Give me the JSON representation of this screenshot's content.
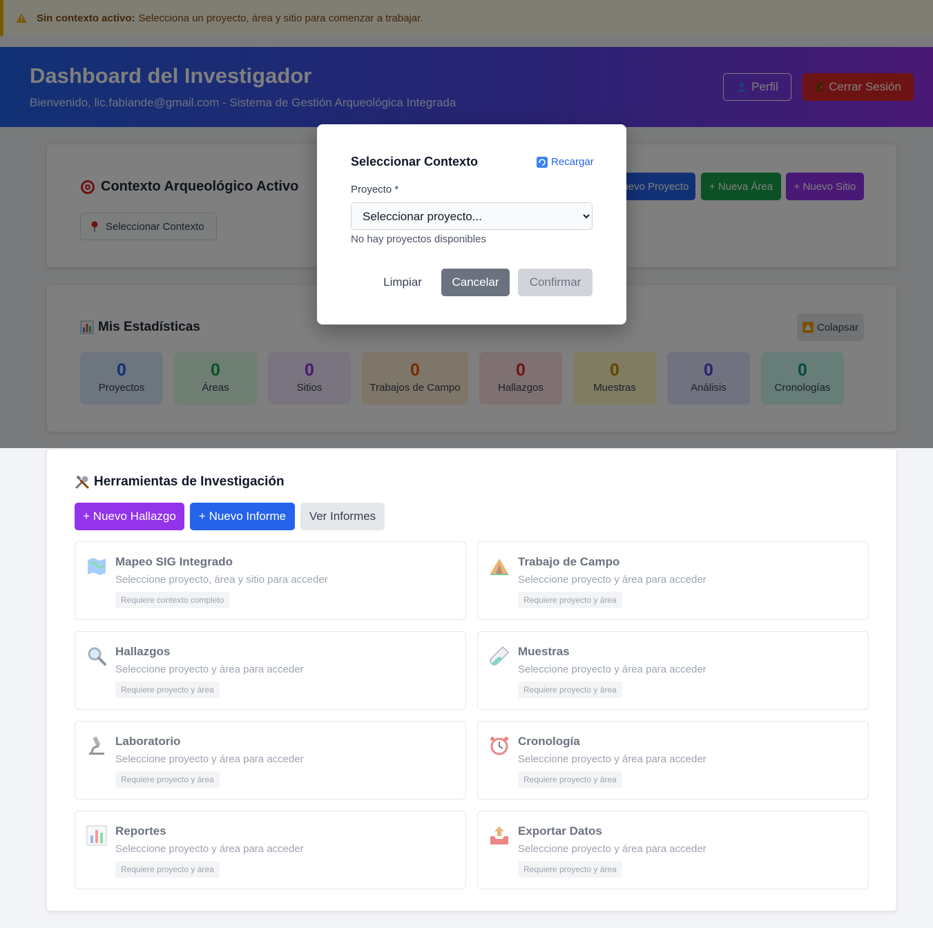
{
  "alert": {
    "title": "Sin contexto activo:",
    "message": "Selecciona un proyecto, área y sitio para comenzar a trabajar."
  },
  "header": {
    "title": "Dashboard del Investigador",
    "subtitle": "Bienvenido, lic.fabiande@gmail.com - Sistema de Gestión Arqueológica Integrada",
    "profile_label": "Perfil",
    "logout_label": "Cerrar Sesión"
  },
  "context": {
    "title": "Contexto Arqueológico Activo",
    "select_label": "Seleccionar Contexto",
    "new_project": "+ Nuevo Proyecto",
    "new_area": "+ Nueva Área",
    "new_site": "+ Nuevo Sitio"
  },
  "stats": {
    "title": "Mis Estadísticas",
    "collapse_label": "Colapsar",
    "items": [
      {
        "value": "0",
        "label": "Proyectos",
        "color": "#2563eb",
        "bg": "#dbeafe"
      },
      {
        "value": "0",
        "label": "Áreas",
        "color": "#16a34a",
        "bg": "#dcfce7"
      },
      {
        "value": "0",
        "label": "Sitios",
        "color": "#9333ea",
        "bg": "#f3e8ff"
      },
      {
        "value": "0",
        "label": "Trabajos de Campo",
        "color": "#ea580c",
        "bg": "#ffedd5"
      },
      {
        "value": "0",
        "label": "Hallazgos",
        "color": "#dc2626",
        "bg": "#fee2e2"
      },
      {
        "value": "0",
        "label": "Muestras",
        "color": "#ca8a04",
        "bg": "#fef9c3"
      },
      {
        "value": "0",
        "label": "Análisis",
        "color": "#4f46e5",
        "bg": "#e0e7ff"
      },
      {
        "value": "0",
        "label": "Cronologías",
        "color": "#0d9488",
        "bg": "#ccfbf1"
      }
    ]
  },
  "modal": {
    "title": "Seleccionar Contexto",
    "reload_label": "Recargar",
    "project_label": "Proyecto *",
    "project_selected": "Seleccionar proyecto...",
    "help_text": "No hay proyectos disponibles",
    "clear_label": "Limpiar",
    "cancel_label": "Cancelar",
    "confirm_label": "Confirmar"
  },
  "tools": {
    "title": "Herramientas de Investigación",
    "new_finding": "+ Nuevo Hallazgo",
    "new_report": "+ Nuevo Informe",
    "view_reports": "Ver Informes",
    "items": [
      {
        "name": "Mapeo SIG Integrado",
        "desc": "Seleccione proyecto, área y sitio para acceder",
        "badge": "Requiere contexto completo",
        "icon": "map-icon"
      },
      {
        "name": "Trabajo de Campo",
        "desc": "Seleccione proyecto y área para acceder",
        "badge": "Requiere proyecto y área",
        "icon": "tent-icon"
      },
      {
        "name": "Hallazgos",
        "desc": "Seleccione proyecto y área para acceder",
        "badge": "Requiere proyecto y área",
        "icon": "magnifier-icon"
      },
      {
        "name": "Muestras",
        "desc": "Seleccione proyecto y área para acceder",
        "badge": "Requiere proyecto y área",
        "icon": "test-tube-icon"
      },
      {
        "name": "Laboratorio",
        "desc": "Seleccione proyecto y área para acceder",
        "badge": "Requiere proyecto y área",
        "icon": "microscope-icon"
      },
      {
        "name": "Cronología",
        "desc": "Seleccione proyecto y área para acceder",
        "badge": "Requiere proyecto y área",
        "icon": "alarm-clock-icon"
      },
      {
        "name": "Reportes",
        "desc": "Seleccione proyecto y área para acceder",
        "badge": "Requiere proyecto y área",
        "icon": "bar-chart-icon"
      },
      {
        "name": "Exportar Datos",
        "desc": "Seleccione proyecto y área para acceder",
        "badge": "Requiere proyecto y área",
        "icon": "outbox-icon"
      }
    ]
  }
}
